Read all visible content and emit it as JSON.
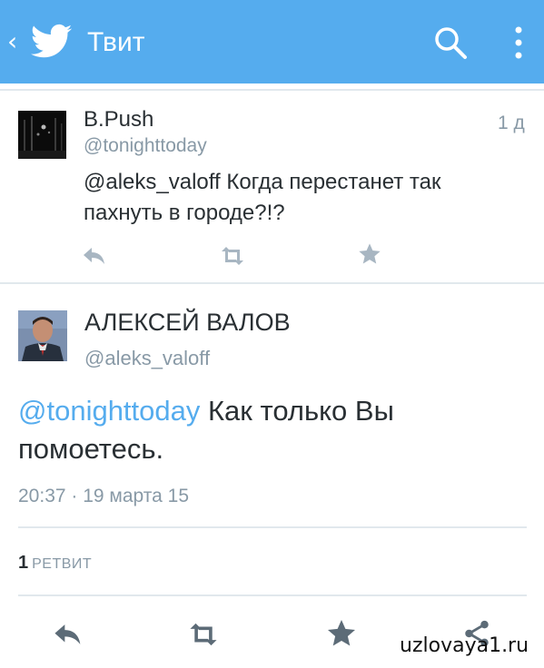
{
  "header": {
    "back_glyph": "‹",
    "title": "Твит",
    "background": "#55acee",
    "icons": [
      "twitter-bird-icon",
      "search-icon",
      "more-vert-icon"
    ]
  },
  "tweet1": {
    "name": "B.Push",
    "handle": "@tonighttoday",
    "time": "1 д",
    "text": "@aleks_valoff Когда перестанет так пахнуть в городе?!?",
    "actions": [
      "reply-icon",
      "retweet-icon",
      "favorite-icon"
    ]
  },
  "tweet2": {
    "name": "АЛЕКСЕЙ ВАЛОВ",
    "handle": "@aleks_valoff",
    "mention": "@tonighttoday",
    "text": " Как только Вы помоетесь.",
    "timestamp": "20:37 · 19 марта 15",
    "retweet_count": "1",
    "retweet_label": "РЕТВИТ",
    "actions": [
      "reply-icon",
      "retweet-icon",
      "favorite-icon",
      "share-icon"
    ]
  },
  "watermark": "uzlovaya1.ru",
  "colors": {
    "accent": "#55acee",
    "muted": "#8899a6",
    "text": "#292f33",
    "icon_gray": "#a8b6c2",
    "icon_dark": "#5c6b77"
  }
}
